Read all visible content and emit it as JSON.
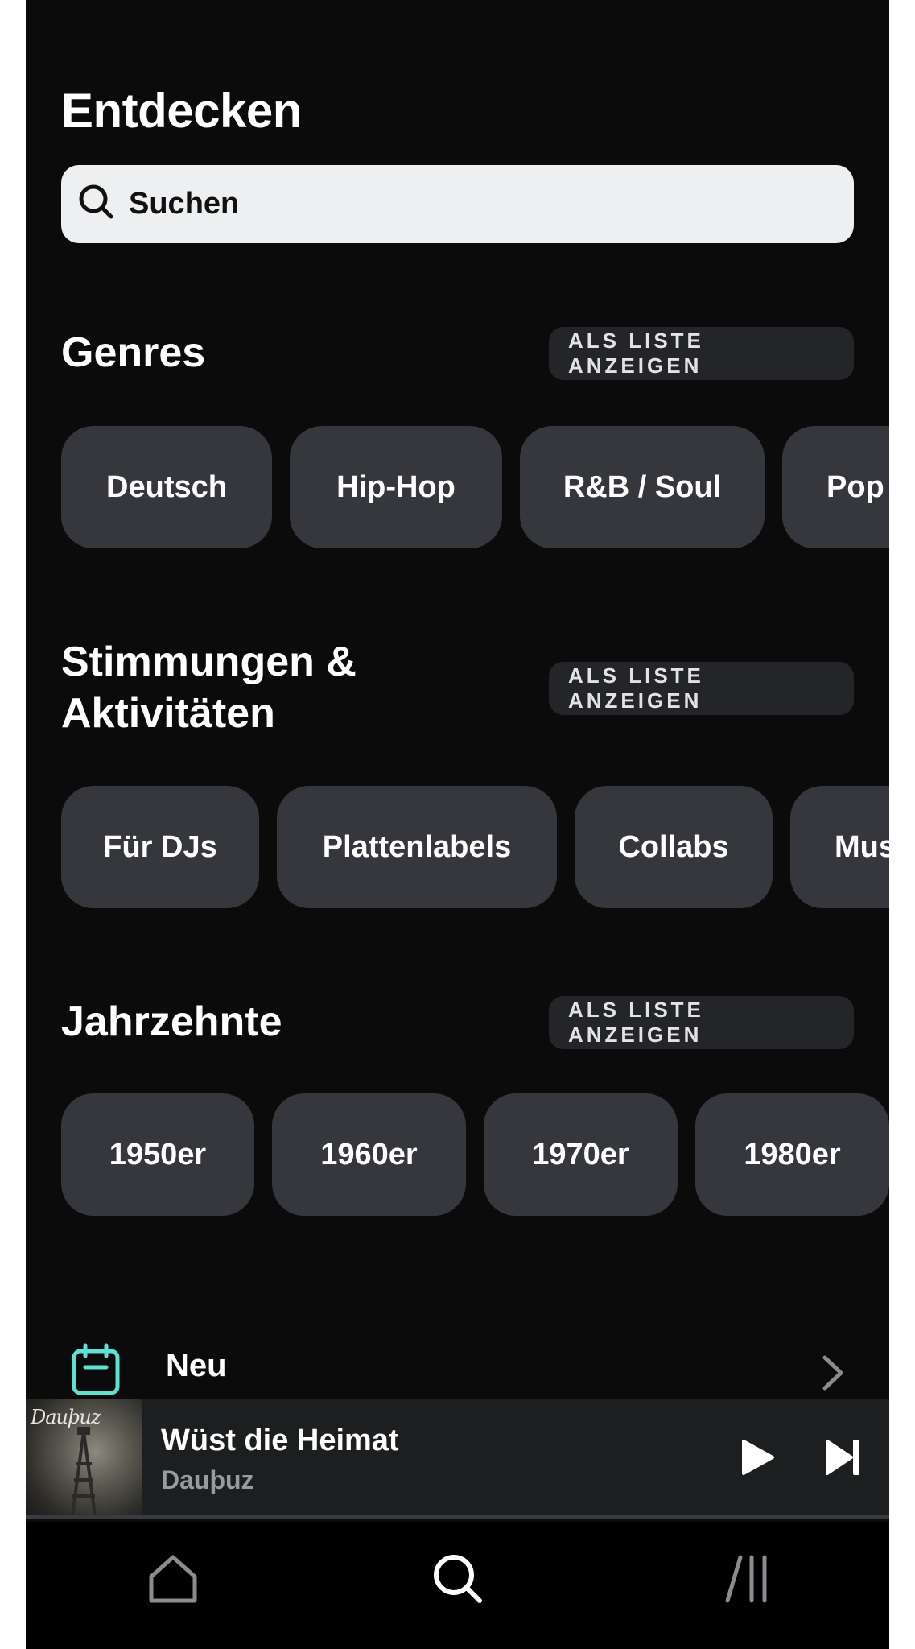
{
  "header": {
    "title": "Entdecken"
  },
  "search": {
    "placeholder": "Suchen"
  },
  "sections": [
    {
      "title": "Genres",
      "list_button": "ALS LISTE ANZEIGEN",
      "chips": [
        "Deutsch",
        "Hip-Hop",
        "R&B / Soul",
        "Pop"
      ]
    },
    {
      "title_line1": "Stimmungen &",
      "title_line2": "Aktivitäten",
      "list_button": "ALS LISTE ANZEIGEN",
      "chips": [
        "Für DJs",
        "Plattenlabels",
        "Collabs",
        "Mus"
      ]
    },
    {
      "title": "Jahrzehnte",
      "list_button": "ALS LISTE ANZEIGEN",
      "chips": [
        "1950er",
        "1960er",
        "1970er",
        "1980er"
      ]
    }
  ],
  "neu_row": {
    "label": "Neu",
    "icon": "calendar-icon",
    "accent": "#5fe0d2"
  },
  "now_playing": {
    "cover_text": "Dauþuz",
    "title": "Wüst die Heimat",
    "artist": "Dauþuz",
    "progress": 0
  },
  "tabbar": {
    "items": [
      {
        "icon": "home-icon",
        "active": false
      },
      {
        "icon": "search-icon",
        "active": true
      },
      {
        "icon": "library-icon",
        "active": false
      }
    ]
  }
}
